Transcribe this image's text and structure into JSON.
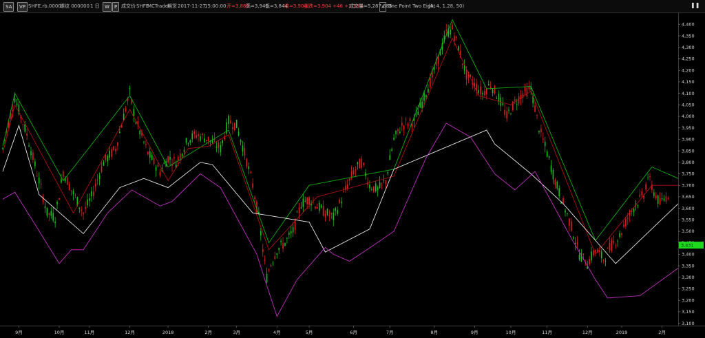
{
  "toolbar": {
    "buttons": [
      "SA",
      "VP"
    ],
    "instrument": "SHFE.rb.0000",
    "contract_name": "螺纹 000000",
    "period": "1 日",
    "period_buttons": [
      "W",
      "P"
    ],
    "volume_label": "成交价",
    "feed": "SHFE",
    "source": "MCTrader",
    "type": "期货",
    "date": "2017-11-27",
    "time": "15:00:00",
    "open": "开=3,889",
    "high": "高=3,945",
    "low": "低=3,844",
    "close": "收=3,904",
    "change": "涨跌=3,904 +46 +1.18%",
    "volume": "成交量=5,287,686",
    "indicator_close": "x",
    "indicator_name": "One Point Two Eight",
    "indicator_params": "(4, 4, 1.28, 50)",
    "menu_icon": "vertical-bars-icon"
  },
  "colors": {
    "background": "#000000",
    "up_candle": "#19c419",
    "down_candle": "#e02020",
    "green_line": "#10b010",
    "red_line": "#b01010",
    "white_line": "#e8e8e8",
    "magenta_line": "#c030c0",
    "price_tag": "#1ed81e"
  },
  "price_tag": "3,431",
  "chart_data": {
    "type": "candlestick",
    "ylim": [
      3090,
      4440
    ],
    "yticks": [
      3100,
      3150,
      3200,
      3250,
      3300,
      3350,
      3400,
      3450,
      3500,
      3550,
      3600,
      3650,
      3700,
      3750,
      3800,
      3850,
      3900,
      3950,
      4000,
      4050,
      4100,
      4150,
      4200,
      4250,
      4300,
      4350,
      4400
    ],
    "ytick_labels": [
      "3,100",
      "3,150",
      "3,200",
      "3,250",
      "3,300",
      "3,350",
      "3,400",
      "3,450",
      "3,500",
      "3,550",
      "3,600",
      "3,650",
      "3,700",
      "3,750",
      "3,800",
      "3,850",
      "3,900",
      "3,950",
      "4,000",
      "4,050",
      "4,100",
      "4,150",
      "4,200",
      "4,250",
      "4,300",
      "4,350",
      "4,400"
    ],
    "n_bars": 330,
    "xticks": [
      {
        "bar": 8,
        "label": "9月"
      },
      {
        "bar": 28,
        "label": "10月"
      },
      {
        "bar": 43,
        "label": "11月"
      },
      {
        "bar": 63,
        "label": "12月"
      },
      {
        "bar": 82,
        "label": "2018"
      },
      {
        "bar": 102,
        "label": "2月"
      },
      {
        "bar": 116,
        "label": "3月"
      },
      {
        "bar": 136,
        "label": "4月"
      },
      {
        "bar": 152,
        "label": "5月"
      },
      {
        "bar": 174,
        "label": "6月"
      },
      {
        "bar": 192,
        "label": "7月"
      },
      {
        "bar": 214,
        "label": "8月"
      },
      {
        "bar": 234,
        "label": "9月"
      },
      {
        "bar": 252,
        "label": "10月"
      },
      {
        "bar": 270,
        "label": "11月"
      },
      {
        "bar": 290,
        "label": "12月"
      },
      {
        "bar": 307,
        "label": "2019"
      },
      {
        "bar": 327,
        "label": "2月"
      }
    ],
    "price_path": [
      [
        0,
        3860
      ],
      [
        6,
        4080
      ],
      [
        12,
        3920
      ],
      [
        18,
        3720
      ],
      [
        22,
        3580
      ],
      [
        26,
        3560
      ],
      [
        30,
        3760
      ],
      [
        34,
        3680
      ],
      [
        40,
        3580
      ],
      [
        44,
        3650
      ],
      [
        50,
        3800
      ],
      [
        56,
        3860
      ],
      [
        60,
        4000
      ],
      [
        63,
        4100
      ],
      [
        66,
        3980
      ],
      [
        72,
        3840
      ],
      [
        78,
        3760
      ],
      [
        82,
        3820
      ],
      [
        86,
        3800
      ],
      [
        92,
        3900
      ],
      [
        96,
        3920
      ],
      [
        102,
        3900
      ],
      [
        108,
        3860
      ],
      [
        112,
        3980
      ],
      [
        116,
        3960
      ],
      [
        120,
        3840
      ],
      [
        124,
        3700
      ],
      [
        127,
        3560
      ],
      [
        129,
        3420
      ],
      [
        131,
        3300
      ],
      [
        133,
        3360
      ],
      [
        136,
        3420
      ],
      [
        140,
        3450
      ],
      [
        144,
        3500
      ],
      [
        148,
        3620
      ],
      [
        152,
        3640
      ],
      [
        156,
        3610
      ],
      [
        160,
        3580
      ],
      [
        164,
        3560
      ],
      [
        168,
        3640
      ],
      [
        174,
        3760
      ],
      [
        178,
        3800
      ],
      [
        182,
        3700
      ],
      [
        186,
        3680
      ],
      [
        190,
        3720
      ],
      [
        194,
        3900
      ],
      [
        198,
        3960
      ],
      [
        204,
        3980
      ],
      [
        208,
        4060
      ],
      [
        212,
        4150
      ],
      [
        216,
        4250
      ],
      [
        220,
        4360
      ],
      [
        223,
        4380
      ],
      [
        226,
        4300
      ],
      [
        230,
        4180
      ],
      [
        234,
        4140
      ],
      [
        238,
        4100
      ],
      [
        242,
        4140
      ],
      [
        246,
        4080
      ],
      [
        250,
        4000
      ],
      [
        254,
        4060
      ],
      [
        258,
        4100
      ],
      [
        262,
        4120
      ],
      [
        266,
        3950
      ],
      [
        270,
        3840
      ],
      [
        274,
        3720
      ],
      [
        278,
        3620
      ],
      [
        282,
        3520
      ],
      [
        286,
        3400
      ],
      [
        290,
        3360
      ],
      [
        294,
        3420
      ],
      [
        298,
        3380
      ],
      [
        302,
        3440
      ],
      [
        306,
        3480
      ],
      [
        310,
        3560
      ],
      [
        314,
        3620
      ],
      [
        318,
        3660
      ],
      [
        320,
        3740
      ],
      [
        322,
        3690
      ],
      [
        326,
        3620
      ],
      [
        330,
        3660
      ],
      [
        333,
        3690
      ]
    ],
    "series": [
      {
        "name": "",
        "color": "#10b010",
        "points": [
          [
            0,
            3870
          ],
          [
            6,
            4100
          ],
          [
            30,
            3720
          ],
          [
            63,
            4090
          ],
          [
            82,
            3780
          ],
          [
            112,
            3940
          ],
          [
            132,
            3450
          ],
          [
            152,
            3700
          ],
          [
            194,
            3770
          ],
          [
            223,
            4420
          ],
          [
            240,
            4120
          ],
          [
            262,
            4130
          ],
          [
            294,
            3460
          ],
          [
            322,
            3780
          ],
          [
            335,
            3730
          ]
        ]
      },
      {
        "name": "",
        "color": "#b01010",
        "points": [
          [
            0,
            3840
          ],
          [
            6,
            4050
          ],
          [
            35,
            3580
          ],
          [
            63,
            4030
          ],
          [
            82,
            3720
          ],
          [
            92,
            3860
          ],
          [
            102,
            3870
          ],
          [
            112,
            3920
          ],
          [
            132,
            3420
          ],
          [
            156,
            3650
          ],
          [
            194,
            3740
          ],
          [
            223,
            4340
          ],
          [
            236,
            4090
          ],
          [
            252,
            4050
          ],
          [
            262,
            4110
          ],
          [
            294,
            3400
          ],
          [
            322,
            3700
          ],
          [
            335,
            3700
          ]
        ]
      },
      {
        "name": "",
        "color": "#e8e8e8",
        "points": [
          [
            0,
            3760
          ],
          [
            8,
            3960
          ],
          [
            18,
            3660
          ],
          [
            40,
            3490
          ],
          [
            58,
            3690
          ],
          [
            70,
            3730
          ],
          [
            82,
            3690
          ],
          [
            98,
            3800
          ],
          [
            104,
            3790
          ],
          [
            124,
            3580
          ],
          [
            152,
            3540
          ],
          [
            160,
            3410
          ],
          [
            182,
            3510
          ],
          [
            194,
            3770
          ],
          [
            240,
            3940
          ],
          [
            244,
            3880
          ],
          [
            262,
            3750
          ],
          [
            278,
            3620
          ],
          [
            304,
            3360
          ],
          [
            335,
            3620
          ]
        ]
      },
      {
        "name": "",
        "color": "#c030c0",
        "points": [
          [
            0,
            3640
          ],
          [
            6,
            3670
          ],
          [
            16,
            3530
          ],
          [
            28,
            3360
          ],
          [
            34,
            3420
          ],
          [
            40,
            3420
          ],
          [
            52,
            3580
          ],
          [
            64,
            3680
          ],
          [
            78,
            3610
          ],
          [
            84,
            3630
          ],
          [
            98,
            3750
          ],
          [
            108,
            3690
          ],
          [
            126,
            3400
          ],
          [
            130,
            3290
          ],
          [
            136,
            3130
          ],
          [
            146,
            3290
          ],
          [
            160,
            3430
          ],
          [
            164,
            3400
          ],
          [
            172,
            3370
          ],
          [
            184,
            3440
          ],
          [
            194,
            3500
          ],
          [
            210,
            3820
          ],
          [
            220,
            3970
          ],
          [
            232,
            3910
          ],
          [
            244,
            3750
          ],
          [
            254,
            3680
          ],
          [
            264,
            3760
          ],
          [
            282,
            3470
          ],
          [
            294,
            3290
          ],
          [
            300,
            3210
          ],
          [
            316,
            3220
          ],
          [
            335,
            3340
          ]
        ]
      }
    ]
  }
}
